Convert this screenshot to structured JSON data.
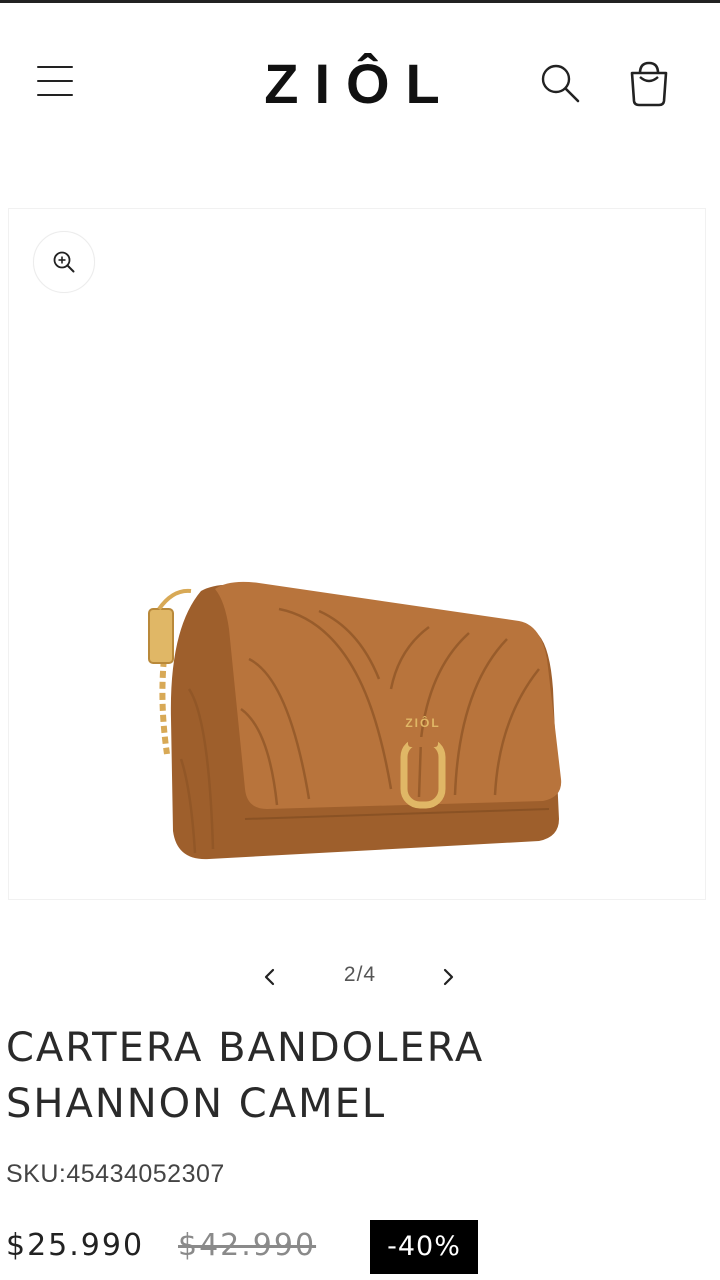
{
  "header": {
    "logo_text": "ZIÔL",
    "icons": {
      "menu": "hamburger-menu-icon",
      "search": "search-icon",
      "cart": "shopping-bag-icon"
    }
  },
  "gallery": {
    "zoom_icon": "zoom-in-icon",
    "image_alt": "Cartera bandolera acolchada color camel con cadena dorada",
    "image_logo_text": "ZIÔL",
    "pager": {
      "prev_icon": "chevron-left-icon",
      "next_icon": "chevron-right-icon",
      "count": "2/4"
    }
  },
  "product": {
    "title_line1": "CARTERA BANDOLERA",
    "title_line2": "SHANNON CAMEL",
    "sku_label": "SKU:",
    "sku_value": "45434052307",
    "price_sale": "$25.990",
    "price_regular": "$42.990",
    "discount": "-40%"
  },
  "colors": {
    "camel": "#B8743C",
    "camel_dark": "#8E5526",
    "gold": "#D8A956",
    "badge_bg": "#000000"
  }
}
